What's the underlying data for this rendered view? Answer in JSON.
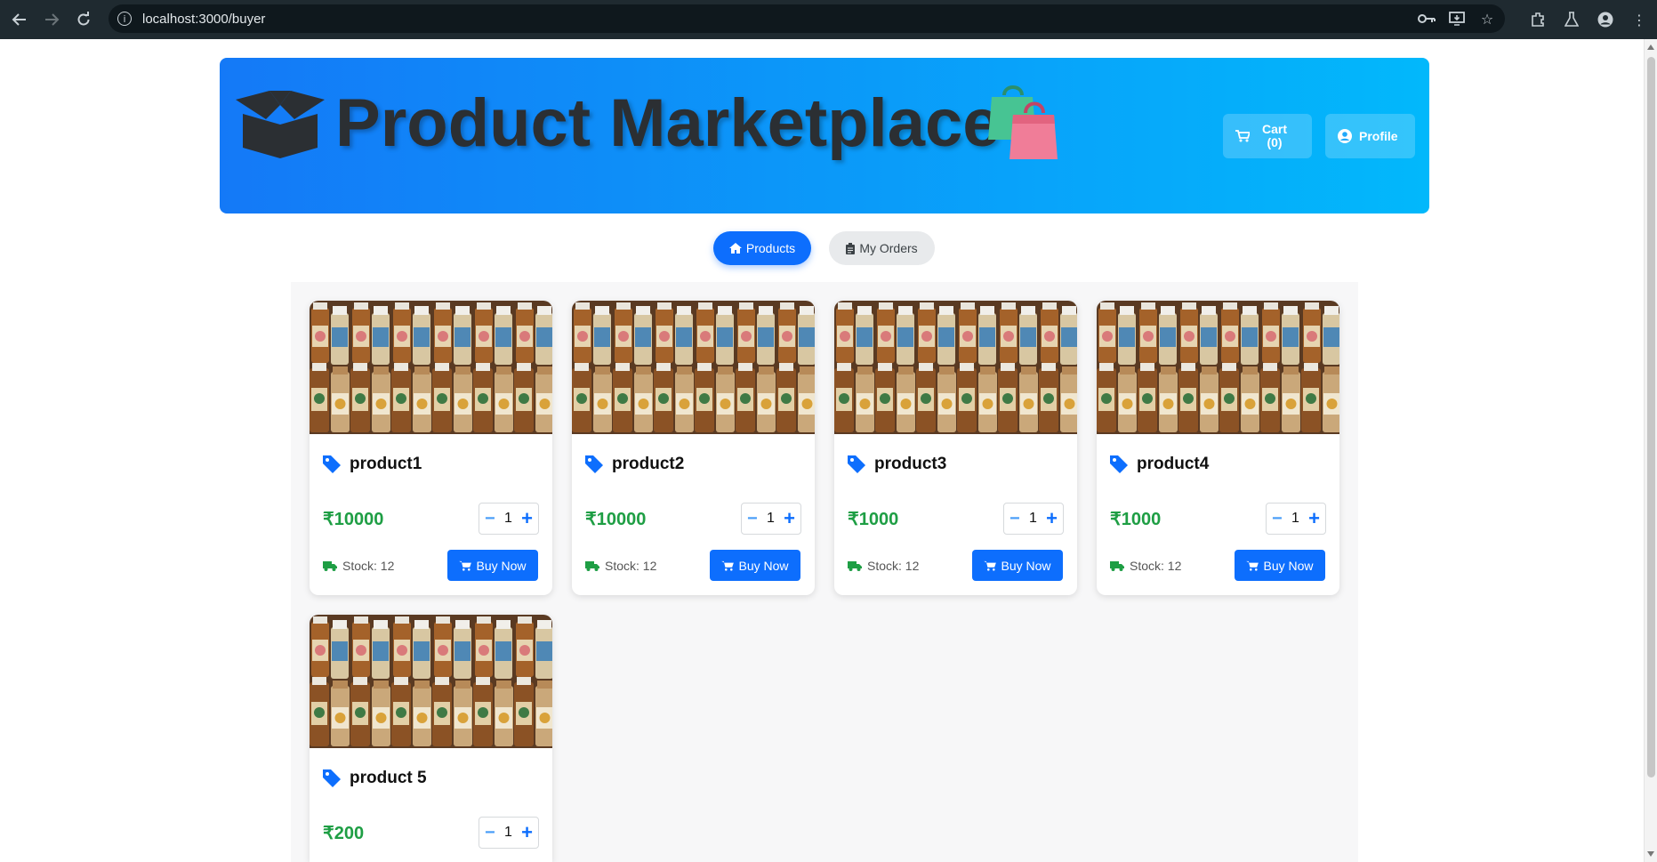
{
  "browser": {
    "url": "localhost:3000/buyer"
  },
  "header": {
    "title": "Product Marketplace",
    "cart_label": "Cart",
    "cart_count": "(0)",
    "profile_label": "Profile"
  },
  "tabs": {
    "products": "Products",
    "orders": "My Orders"
  },
  "products": [
    {
      "name": "product1",
      "price": "₹10000",
      "qty": "1",
      "stock": "Stock: 12",
      "buy": "Buy Now"
    },
    {
      "name": "product2",
      "price": "₹10000",
      "qty": "1",
      "stock": "Stock: 12",
      "buy": "Buy Now"
    },
    {
      "name": "product3",
      "price": "₹1000",
      "qty": "1",
      "stock": "Stock: 12",
      "buy": "Buy Now"
    },
    {
      "name": "product4",
      "price": "₹1000",
      "qty": "1",
      "stock": "Stock: 12",
      "buy": "Buy Now"
    },
    {
      "name": "product 5",
      "price": "₹200",
      "qty": "1",
      "stock": "",
      "buy": ""
    }
  ],
  "colors": {
    "accent": "#0d6efd",
    "price": "#1e9e44",
    "header_start": "#1479f7",
    "header_end": "#02b8fb"
  },
  "icons": [
    "back-icon",
    "forward-icon",
    "reload-icon",
    "info-icon",
    "key-icon",
    "install-icon",
    "star-icon",
    "extensions-icon",
    "labs-icon",
    "account-icon",
    "menu-icon",
    "box-icon",
    "shopping-bags-icon",
    "cart-icon",
    "user-circle-icon",
    "home-icon",
    "clipboard-icon",
    "tag-icon",
    "truck-icon"
  ]
}
